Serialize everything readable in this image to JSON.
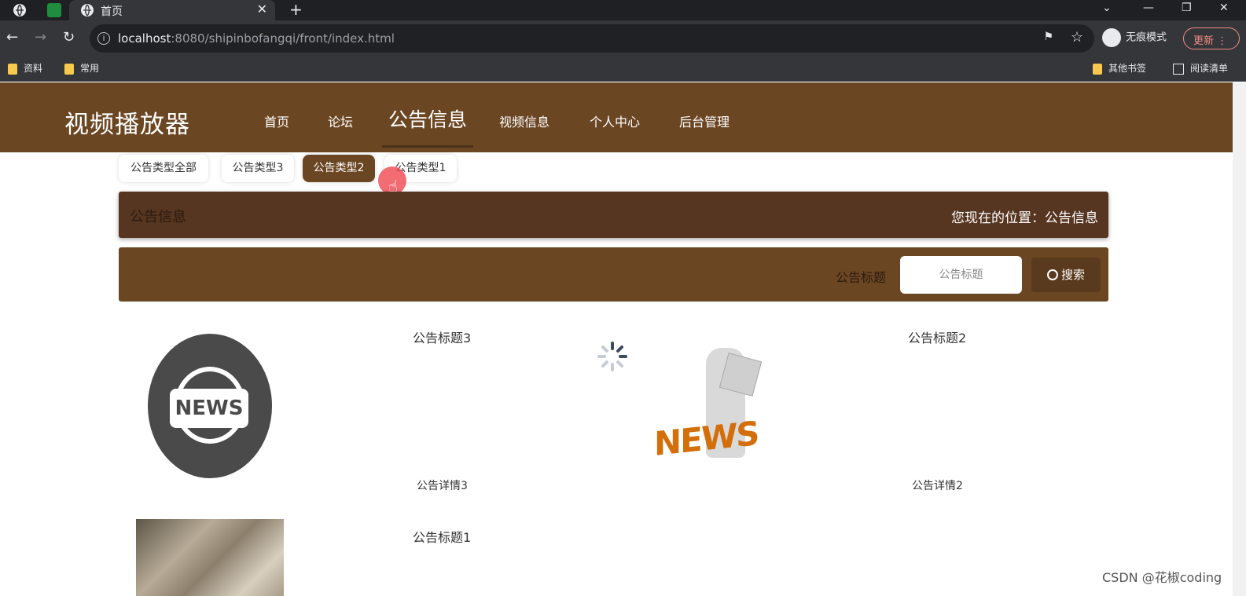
{
  "browser": {
    "tab_title": "首页",
    "url_host": "localhost",
    "url_rest": ":8080/shipinbofangqi/front/index.html",
    "incognito_label": "无痕模式",
    "update_label": "更新",
    "bookmarks": [
      "资料",
      "常用"
    ],
    "bookmarks_right": [
      "其他书签",
      "阅读清单"
    ]
  },
  "site": {
    "title": "视频播放器",
    "nav": [
      "首页",
      "论坛",
      "公告信息",
      "视频信息",
      "个人中心",
      "后台管理"
    ],
    "active_nav": "公告信息"
  },
  "types": {
    "buttons": [
      "公告类型全部",
      "公告类型3",
      "公告类型2",
      "公告类型1"
    ],
    "selected": "公告类型2"
  },
  "breadcrumb": {
    "title": "公告信息",
    "location": "您现在的位置：公告信息"
  },
  "search": {
    "label": "公告标题",
    "placeholder": "公告标题",
    "button_label": "搜索"
  },
  "notices": [
    {
      "title": "公告标题3",
      "detail": "公告详情3",
      "image": "news-globe-icon"
    },
    {
      "title": "公告标题2",
      "detail": "公告详情2",
      "image": "news-reader-image"
    },
    {
      "title": "公告标题1",
      "detail": "",
      "image": "paper-photo"
    }
  ],
  "watermark": "CSDN @花椒coding",
  "colors": {
    "header_brown": "#6b4623",
    "breadcrumb_brown": "#563521",
    "accent_dark": "#5a3a1e"
  }
}
